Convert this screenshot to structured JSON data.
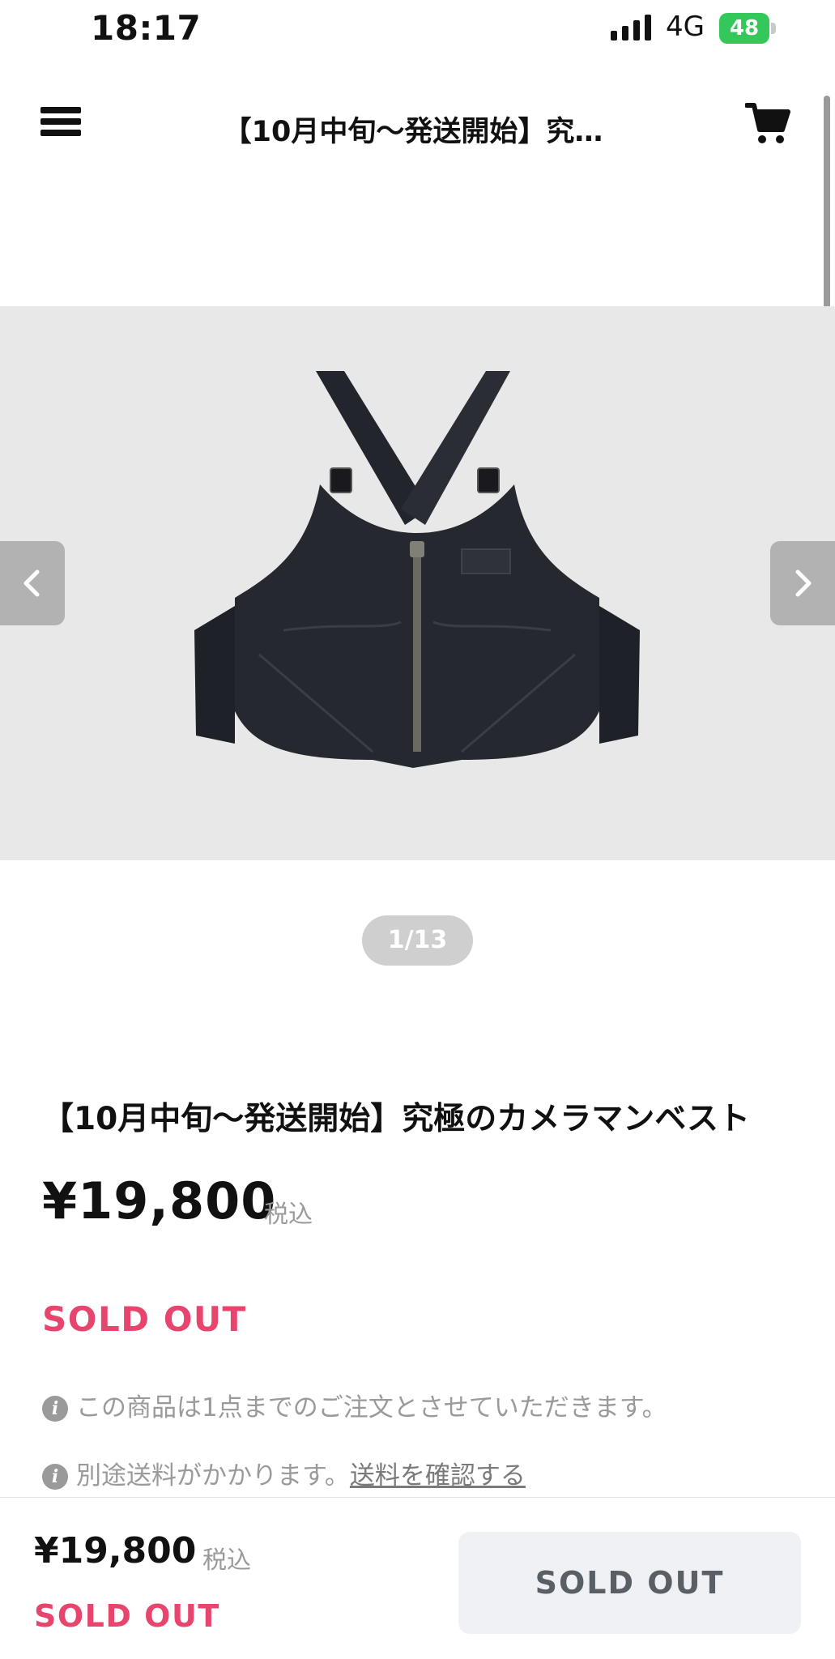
{
  "status_bar": {
    "time": "18:17",
    "network": "4G",
    "battery_level": "48",
    "battery_color": "#34c759",
    "icons": [
      "signal-icon",
      "battery-icon"
    ]
  },
  "header": {
    "title": "【10月中旬〜発送開始】究…",
    "icons": [
      "menu-icon",
      "cart-icon"
    ]
  },
  "carousel": {
    "image_label": "navy vest product image",
    "counter": "1/13",
    "prev_icon": "chevron-left-icon",
    "next_icon": "chevron-right-icon"
  },
  "product": {
    "title": "【10月中旬〜発送開始】究極のカメラマンベスト",
    "price": "¥19,800",
    "tax_label": "税込",
    "status": "SOLD OUT",
    "status_color": "#e8456e",
    "notes": {
      "limit": "この商品は1点までのご注文とさせていただきます。",
      "shipping_prefix": "別途送料がかかります。",
      "shipping_link": "送料を確認する"
    },
    "note_icon": "info-icon"
  },
  "bottom_bar": {
    "price": "¥19,800",
    "tax_label": "税込",
    "status": "SOLD OUT",
    "button_label": "SOLD OUT"
  }
}
